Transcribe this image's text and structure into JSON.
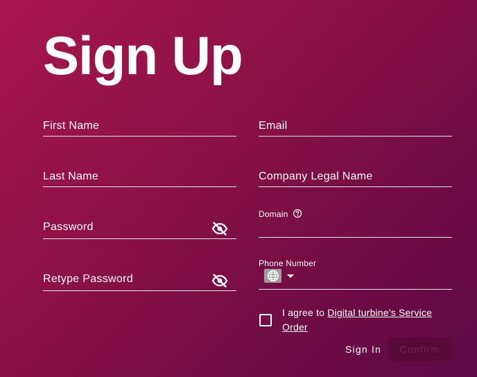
{
  "title": "Sign Up",
  "form": {
    "first_name_label": "First Name",
    "last_name_label": "Last Name",
    "password_label": "Password",
    "retype_password_label": "Retype Password",
    "email_label": "Email",
    "company_label": "Company Legal Name",
    "domain_label": "Domain",
    "phone_label": "Phone Number",
    "agree_prefix": "I agree to ",
    "agree_link": "Digital turbine's Service Order"
  },
  "actions": {
    "signin_label": "Sign In",
    "confirm_label": "Confirm"
  },
  "icons": {
    "password_toggle": "eye-off-icon",
    "retype_toggle": "eye-off-icon",
    "domain_help": "help-circle-icon",
    "phone_country": "globe-icon",
    "phone_dropdown": "caret-down-icon"
  },
  "colors": {
    "gradient_start": "#a8174c",
    "gradient_end": "#5c0a45",
    "text": "#ffffff"
  }
}
